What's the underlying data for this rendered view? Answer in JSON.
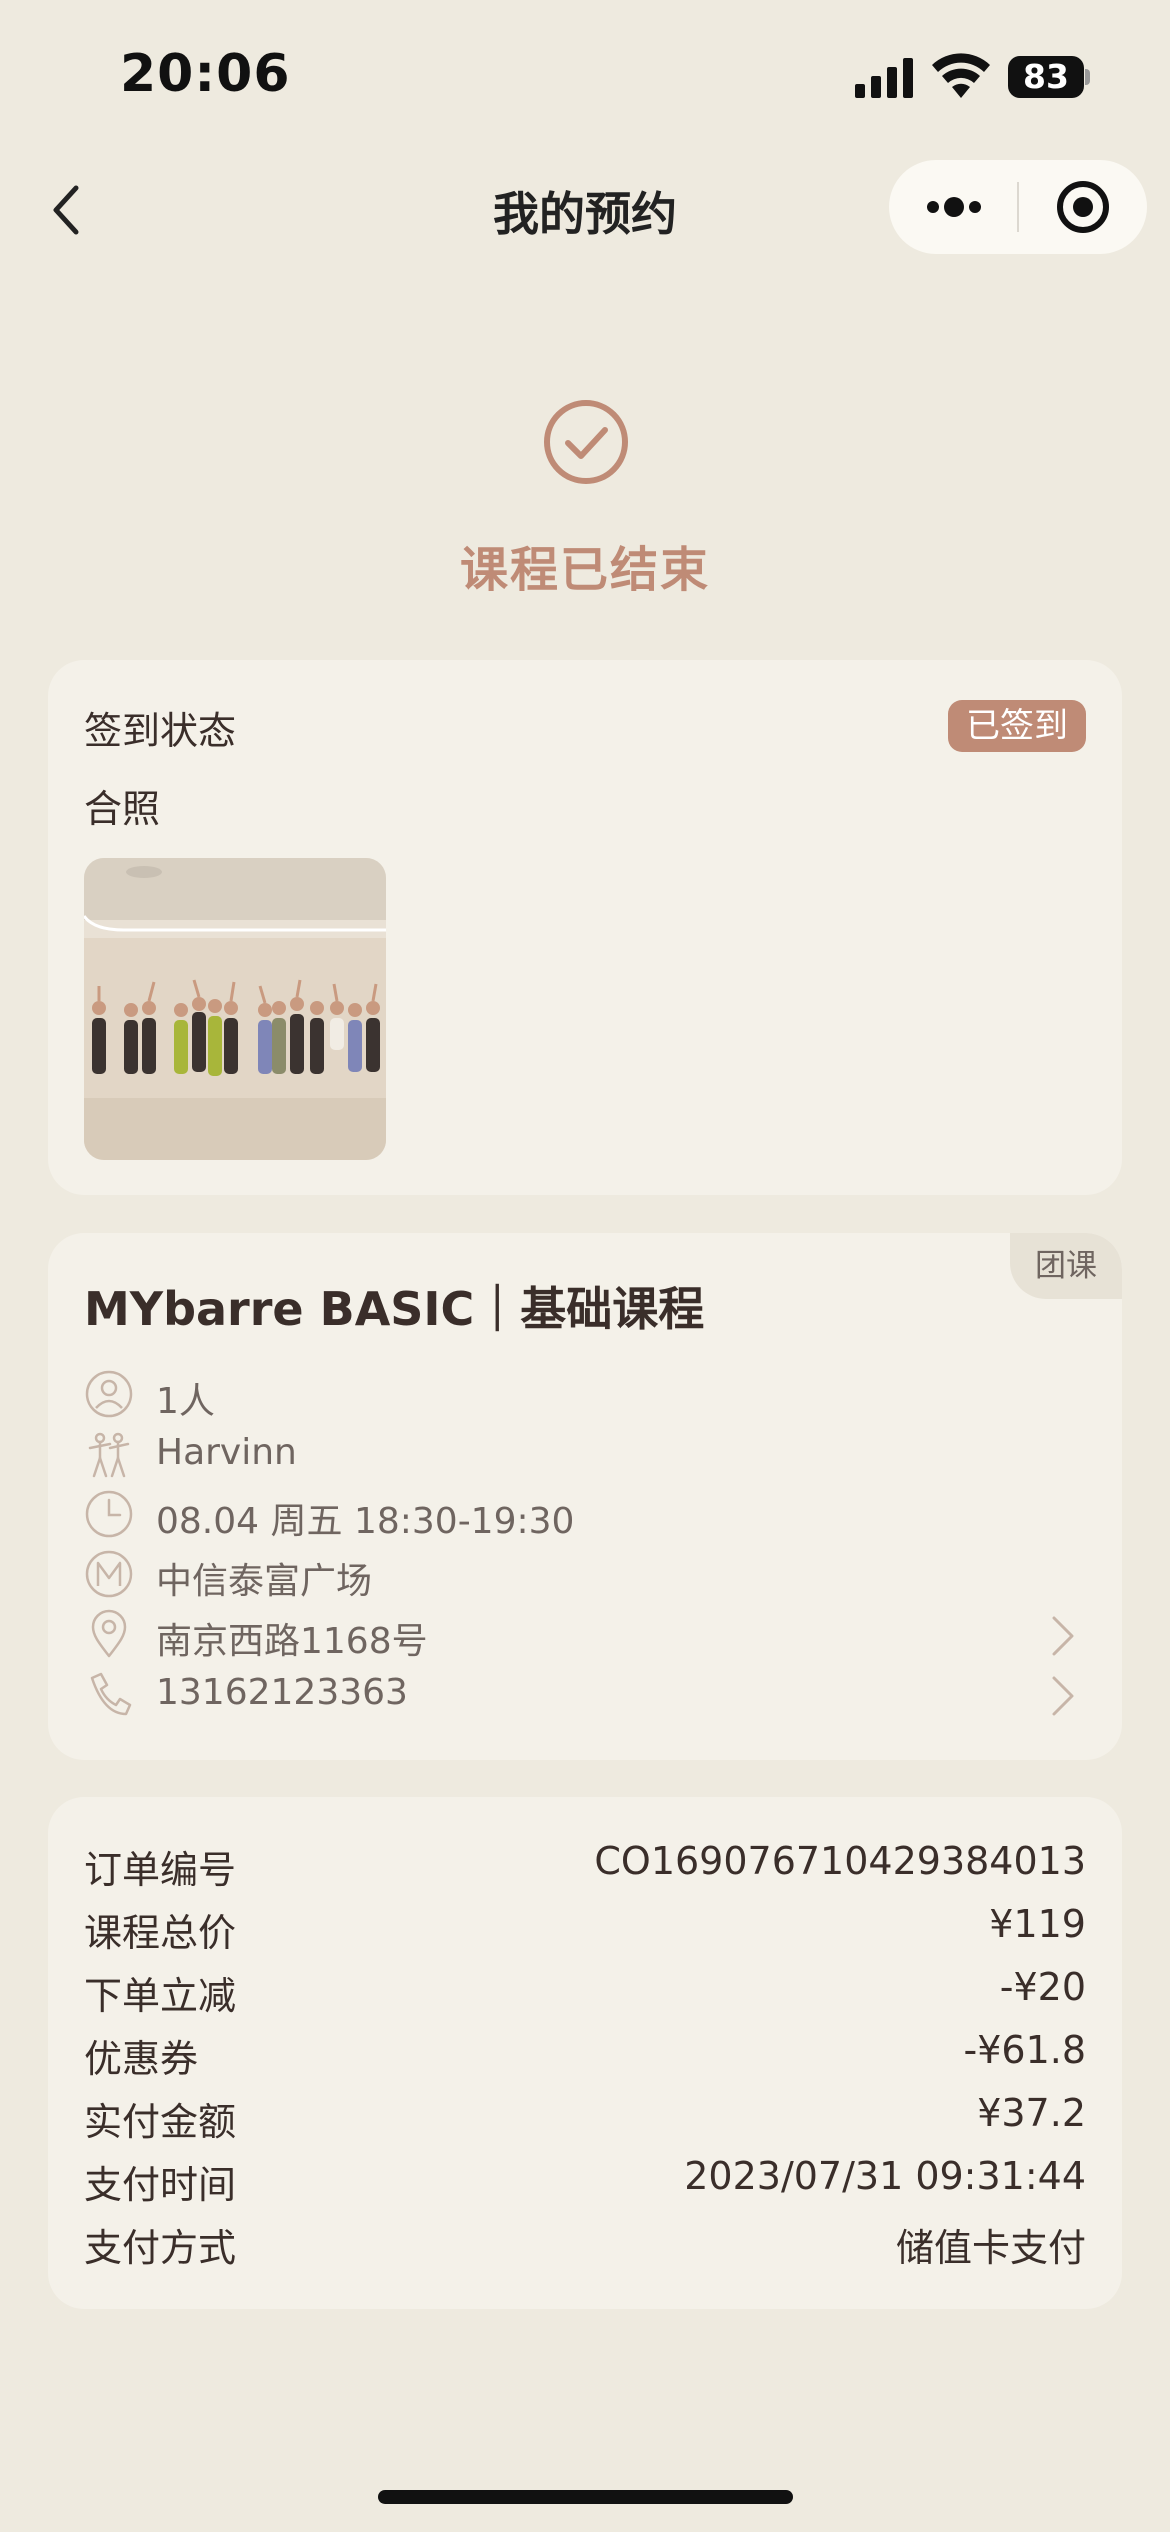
{
  "status_bar": {
    "time": "20:06",
    "battery": "83"
  },
  "nav": {
    "title": "我的预约"
  },
  "booking_status": {
    "title": "课程已结束"
  },
  "checkin_card": {
    "status_label": "签到状态",
    "status_badge": "已签到",
    "photo_label": "合照"
  },
  "course_card": {
    "tag": "团课",
    "title": "MYbarre BASIC｜基础课程",
    "rows": [
      {
        "icon": "person-icon",
        "text": "1人"
      },
      {
        "icon": "dancer-icon",
        "text": "Harvinn"
      },
      {
        "icon": "clock-icon",
        "text": "08.04 周五 18:30-19:30"
      },
      {
        "icon": "m-logo-icon",
        "text": "中信泰富广场"
      },
      {
        "icon": "location-pin-icon",
        "text": "南京西路1168号"
      },
      {
        "icon": "phone-icon",
        "text": "13162123363"
      }
    ]
  },
  "order_card": {
    "rows": [
      {
        "label": "订单编号",
        "value": "CO169076710429384013"
      },
      {
        "label": "课程总价",
        "value": "¥119"
      },
      {
        "label": "下单立减",
        "value": "-¥20"
      },
      {
        "label": "优惠券",
        "value": "-¥61.8"
      },
      {
        "label": "实付金额",
        "value": "¥37.2"
      },
      {
        "label": "支付时间",
        "value": "2023/07/31 09:31:44"
      },
      {
        "label": "支付方式",
        "value": "储值卡支付"
      }
    ]
  },
  "colors": {
    "background": "#eeeadf",
    "card": "#f4f1e9",
    "accent": "#bf8b76",
    "text_primary": "#3a2e2a",
    "text_secondary": "#6f6560"
  }
}
